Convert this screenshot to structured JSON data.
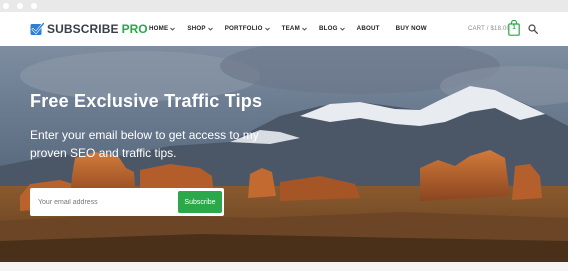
{
  "brand": {
    "name": "SUBSCRIBE",
    "suffix": "PRO",
    "logo_icon": "checkbox-icon",
    "accent_color": "#29a847"
  },
  "nav": {
    "items": [
      {
        "label": "HOME",
        "has_dropdown": true
      },
      {
        "label": "SHOP",
        "has_dropdown": true
      },
      {
        "label": "PORTFOLIO",
        "has_dropdown": true
      },
      {
        "label": "TEAM",
        "has_dropdown": true
      },
      {
        "label": "BLOG",
        "has_dropdown": true
      },
      {
        "label": "ABOUT",
        "has_dropdown": false
      },
      {
        "label": "BUY NOW",
        "has_dropdown": false
      }
    ]
  },
  "cart": {
    "label": "CART / $18.00",
    "count": "1",
    "icon": "shopping-bag-icon"
  },
  "search": {
    "icon": "search-icon"
  },
  "hero": {
    "title": "Free Exclusive Traffic Tips",
    "subtitle": "Enter your email below to get access to my proven SEO and traffic tips.",
    "email_placeholder": "Your email address",
    "button_label": "Subscribe",
    "button_color": "#2aa84a"
  }
}
